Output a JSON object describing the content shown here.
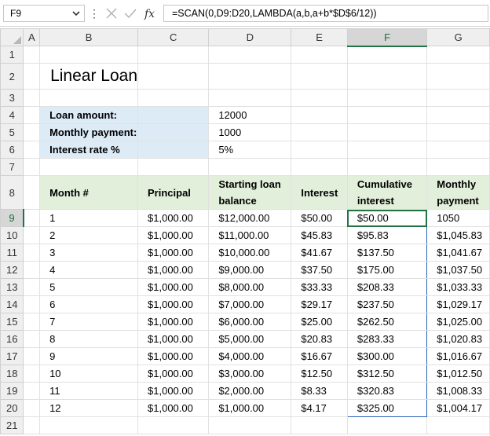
{
  "formula_bar": {
    "name_box": "F9",
    "formula": "=SCAN(0,D9:D20,LAMBDA(a,b,a+b*$D$6/12))",
    "fx_label": "fx"
  },
  "columns": [
    "A",
    "B",
    "C",
    "D",
    "E",
    "F",
    "G"
  ],
  "rows": [
    "1",
    "2",
    "3",
    "4",
    "5",
    "6",
    "7",
    "8",
    "9",
    "10",
    "11",
    "12",
    "13",
    "14",
    "15",
    "16",
    "17",
    "18",
    "19",
    "20",
    "21"
  ],
  "sheet": {
    "title": "Linear Loan",
    "inputs": [
      {
        "label": "Loan amount:",
        "value": "12000"
      },
      {
        "label": "Monthly payment:",
        "value": "1000"
      },
      {
        "label": "Interest rate %",
        "value": "5%"
      }
    ],
    "table_headers": [
      "Month #",
      "Principal",
      "Starting loan balance",
      "Interest",
      "Cumulative interest",
      "Monthly payment"
    ],
    "table_rows": [
      [
        "1",
        "$1,000.00",
        "$12,000.00",
        "$50.00",
        "$50.00",
        "1050"
      ],
      [
        "2",
        "$1,000.00",
        "$11,000.00",
        "$45.83",
        "$95.83",
        "$1,045.83"
      ],
      [
        "3",
        "$1,000.00",
        "$10,000.00",
        "$41.67",
        "$137.50",
        "$1,041.67"
      ],
      [
        "4",
        "$1,000.00",
        "$9,000.00",
        "$37.50",
        "$175.00",
        "$1,037.50"
      ],
      [
        "5",
        "$1,000.00",
        "$8,000.00",
        "$33.33",
        "$208.33",
        "$1,033.33"
      ],
      [
        "6",
        "$1,000.00",
        "$7,000.00",
        "$29.17",
        "$237.50",
        "$1,029.17"
      ],
      [
        "7",
        "$1,000.00",
        "$6,000.00",
        "$25.00",
        "$262.50",
        "$1,025.00"
      ],
      [
        "8",
        "$1,000.00",
        "$5,000.00",
        "$20.83",
        "$283.33",
        "$1,020.83"
      ],
      [
        "9",
        "$1,000.00",
        "$4,000.00",
        "$16.67",
        "$300.00",
        "$1,016.67"
      ],
      [
        "10",
        "$1,000.00",
        "$3,000.00",
        "$12.50",
        "$312.50",
        "$1,012.50"
      ],
      [
        "11",
        "$1,000.00",
        "$2,000.00",
        "$8.33",
        "$320.83",
        "$1,008.33"
      ],
      [
        "12",
        "$1,000.00",
        "$1,000.00",
        "$4.17",
        "$325.00",
        "$1,004.17"
      ]
    ]
  },
  "colors": {
    "input_label_fill": "#ddebf7",
    "table_header_fill": "#e2efda",
    "selection_green": "#217346",
    "spill_border": "#2b5fb3"
  }
}
